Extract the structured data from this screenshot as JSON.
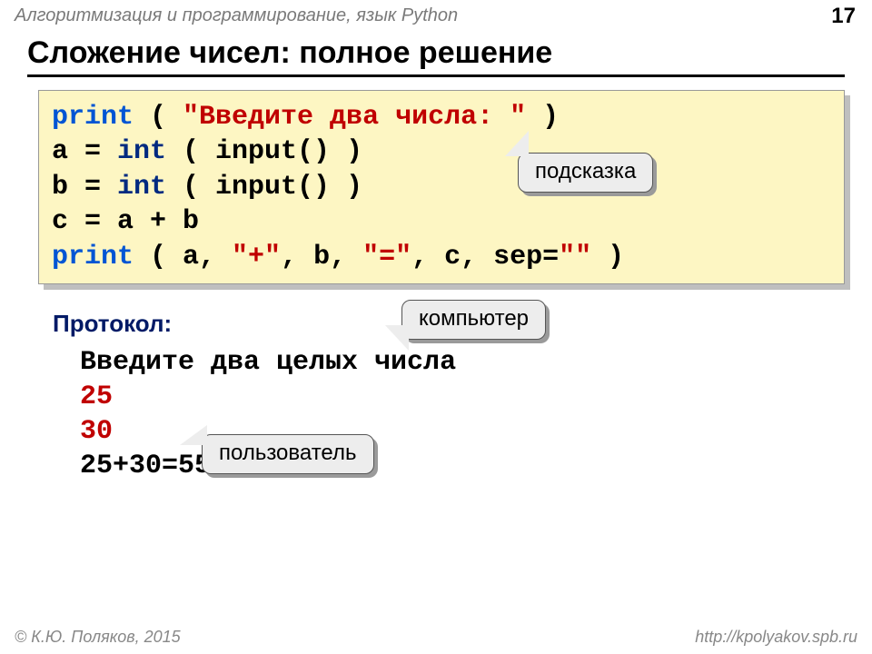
{
  "header": {
    "subject": "Алгоритмизация и программирование, язык Python",
    "page_number": "17"
  },
  "title": "Сложение чисел: полное решение",
  "code": {
    "l1": {
      "kw": "print",
      "rest_pre": " ( ",
      "str": "\"Введите два числа: \"",
      "rest_post": " )"
    },
    "l2": {
      "pre": "a = ",
      "kw": "int",
      "rest": " ( input() )"
    },
    "l3": {
      "pre": "b = ",
      "kw": "int",
      "rest": " ( input() )"
    },
    "l4": "c = a + b",
    "l5": {
      "kw": "print",
      "mid1": " ( a, ",
      "s1": "\"+\"",
      "mid2": ", b, ",
      "s2": "\"=\"",
      "mid3": ", c, sep=",
      "s3": "\"\"",
      "end": " )"
    }
  },
  "callouts": {
    "hint": "подсказка",
    "computer": "компьютер",
    "user": "пользователь"
  },
  "protocol": {
    "label": "Протокол:",
    "line1": "  Введите два целых числа",
    "line2": "  25",
    "line3": "  30",
    "line4": "  25+30=55"
  },
  "footer": {
    "left": "© К.Ю. Поляков, 2015",
    "right": "http://kpolyakov.spb.ru"
  }
}
